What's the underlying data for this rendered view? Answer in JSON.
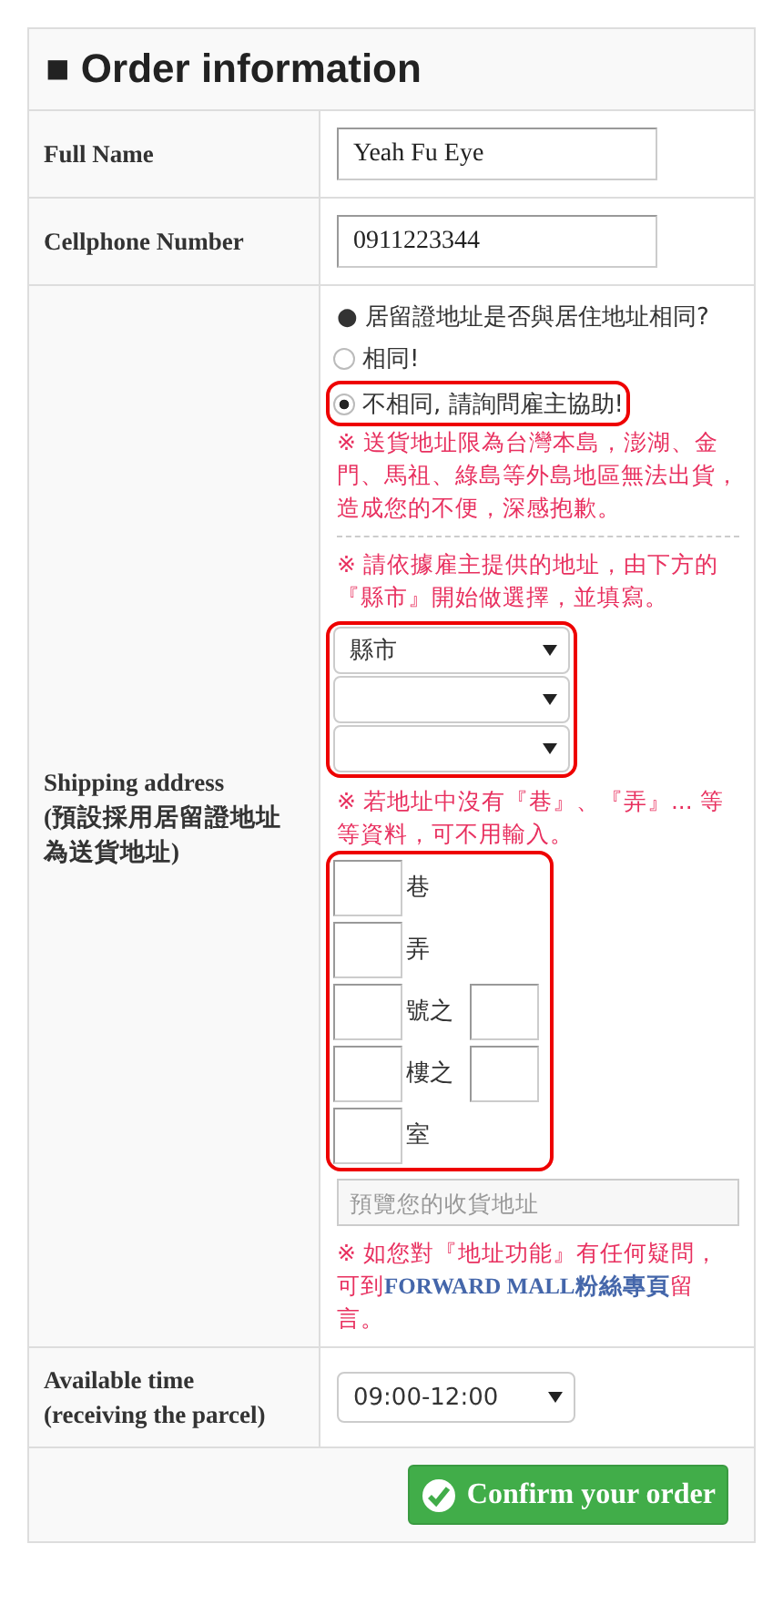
{
  "title_mark": "■",
  "title": "Order information",
  "full_name": {
    "label": "Full Name",
    "value": "Yeah Fu Eye"
  },
  "cellphone": {
    "label": "Cellphone Number",
    "value": "0911223344"
  },
  "shipping": {
    "label": "Shipping address",
    "sublabel": "(預設採用居留證地址為送貨地址)",
    "bullet": "●",
    "question": "居留證地址是否與居住地址相同?",
    "options": [
      {
        "label": "相同!",
        "selected": false,
        "highlighted": false
      },
      {
        "label": "不相同, 請詢問雇主協助!",
        "selected": true,
        "highlighted": true
      }
    ],
    "notice": "※ 送貨地址限為台灣本島，澎湖、金門、馬祖、綠島等外島地區無法出貨，造成您的不便，深感抱歉。",
    "instruction": "※ 請依據雇主提供的地址，由下方的『縣市』開始做選擇，並填寫。",
    "selects_highlighted": true,
    "selects": [
      {
        "kind": "city",
        "value": "縣市"
      },
      {
        "kind": "blank"
      },
      {
        "kind": "blank"
      }
    ],
    "optional_note": "※ 若地址中沒有『巷』、『弄』... 等等資料，可不用輸入。",
    "parts_highlighted": true,
    "parts": [
      {
        "label": "巷",
        "extra_field": false
      },
      {
        "label": "弄",
        "extra_field": false
      },
      {
        "label": "號之",
        "extra_field": true
      },
      {
        "label": "樓之",
        "extra_field": true
      },
      {
        "label": "室",
        "extra_field": false
      }
    ],
    "preview_placeholder": "預覽您的收貨地址",
    "help": {
      "before": "※ 如您對『地址功能』有任何疑問，可到",
      "link": "FORWARD MALL粉絲專頁",
      "after": "留言。"
    }
  },
  "time": {
    "label": "Available time (receiving the parcel)",
    "value": "09:00-12:00"
  },
  "confirm": "Confirm your order"
}
